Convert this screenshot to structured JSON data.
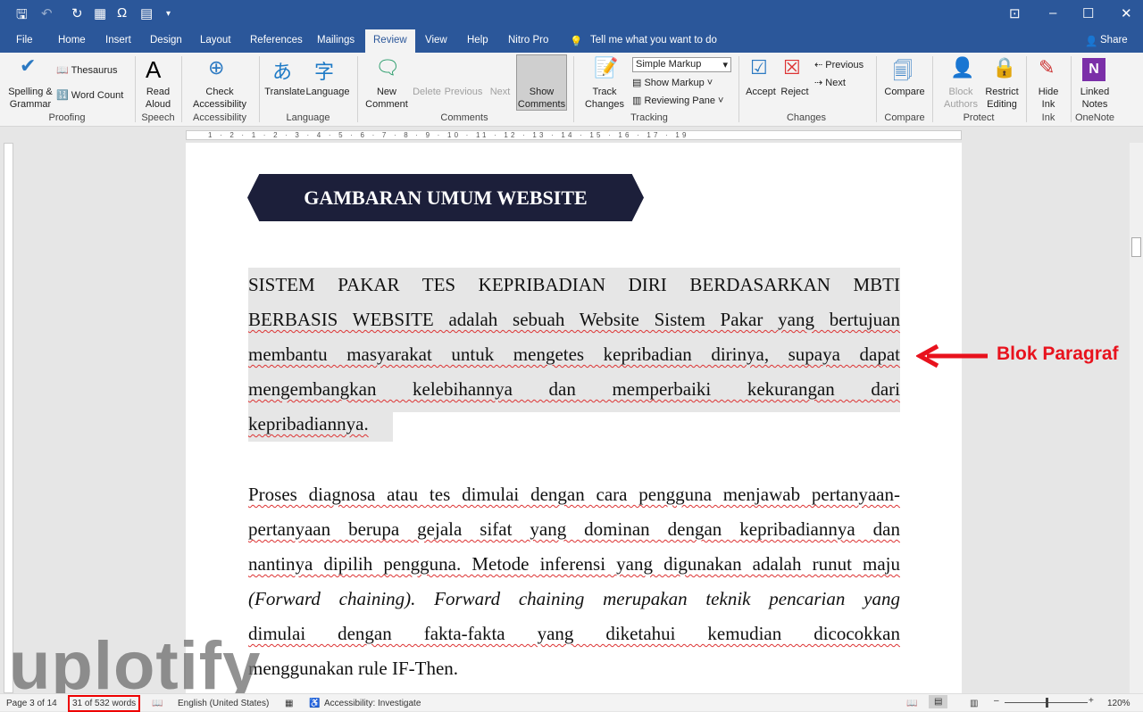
{
  "titlebar": {
    "qat_icons": [
      "save-icon",
      "undo-icon",
      "redo-icon",
      "table-icon",
      "omega-icon",
      "document-icon",
      "customize-icon"
    ],
    "window_icons": [
      "ribbon-display-icon",
      "minimize-icon",
      "maximize-icon",
      "close-icon"
    ]
  },
  "tabs": [
    "File",
    "Home",
    "Insert",
    "Design",
    "Layout",
    "References",
    "Mailings",
    "Review",
    "View",
    "Help",
    "Nitro Pro"
  ],
  "active_tab": "Review",
  "tell_me": "Tell me what you want to do",
  "share": "Share",
  "ribbon": {
    "spelling": "Spelling &",
    "grammar": "Grammar",
    "thesaurus": "Thesaurus",
    "word_count": "Word Count",
    "proofing": "Proofing",
    "read": "Read",
    "aloud": "Aloud",
    "speech": "Speech",
    "check": "Check",
    "accessibility_btn": "Accessibility",
    "accessibility": "Accessibility",
    "translate": "Translate",
    "language_btn": "Language",
    "language": "Language",
    "new": "New",
    "comment": "Comment",
    "delete": "Delete",
    "previous": "Previous",
    "next": "Next",
    "show": "Show",
    "comments_btn": "Comments",
    "comments": "Comments",
    "track": "Track",
    "changes_btn": "Changes",
    "simple_markup": "Simple Markup",
    "show_markup": "Show Markup",
    "reviewing_pane": "Reviewing Pane",
    "tracking": "Tracking",
    "accept": "Accept",
    "reject": "Reject",
    "prev_change": "Previous",
    "next_change": "Next",
    "changes": "Changes",
    "compare_btn": "Compare",
    "compare": "Compare",
    "block": "Block",
    "authors": "Authors",
    "restrict": "Restrict",
    "editing": "Editing",
    "protect": "Protect",
    "hide": "Hide",
    "ink_btn": "Ink",
    "ink": "Ink",
    "linked": "Linked",
    "notes": "Notes",
    "onenote": "OneNote"
  },
  "ruler": "1 · 2 · 1 · 2 · 3 · 4 · 5 · 6 · 7 · 8 · 9 · 10 · 11 · 12 · 13 · 14 · 15 · 16 · 17 · 19",
  "document": {
    "heading": "GAMBARAN UMUM WEBSITE",
    "paragraph1": [
      "SISTEM PAKAR TES KEPRIBADIAN DIRI BERDASARKAN MBTI",
      "BERBASIS WEBSITE adalah sebuah Website Sistem Pakar yang bertujuan",
      "membantu masyarakat untuk mengetes kepribadian dirinya, supaya dapat",
      "mengembangkan kelebihannya dan memperbaiki kekurangan dari",
      "kepribadiannya."
    ],
    "paragraph2": [
      "Proses diagnosa atau tes dimulai dengan cara pengguna menjawab pertanyaan-",
      "pertanyaan berupa gejala sifat yang dominan dengan kepribadiannya dan",
      "nantinya dipilih pengguna. Metode inferensi yang digunakan adalah runut maju",
      "(Forward chaining). Forward chaining  merupakan teknik pencarian yang",
      "dimulai dengan fakta-fakta yang diketahui kemudian dicocokkan",
      "menggunakan  rule IF-Then."
    ]
  },
  "annotation": "Blok Paragraf",
  "watermark": "uplotify",
  "status": {
    "page": "Page 3 of 14",
    "words": "31 of 532 words",
    "language": "English (United States)",
    "accessibility": "Accessibility: Investigate",
    "zoom": "120%",
    "zoom_level": 120
  },
  "colors": {
    "accent": "#2b579a",
    "annotation": "#e8121d",
    "banner": "#1c1f3a"
  }
}
